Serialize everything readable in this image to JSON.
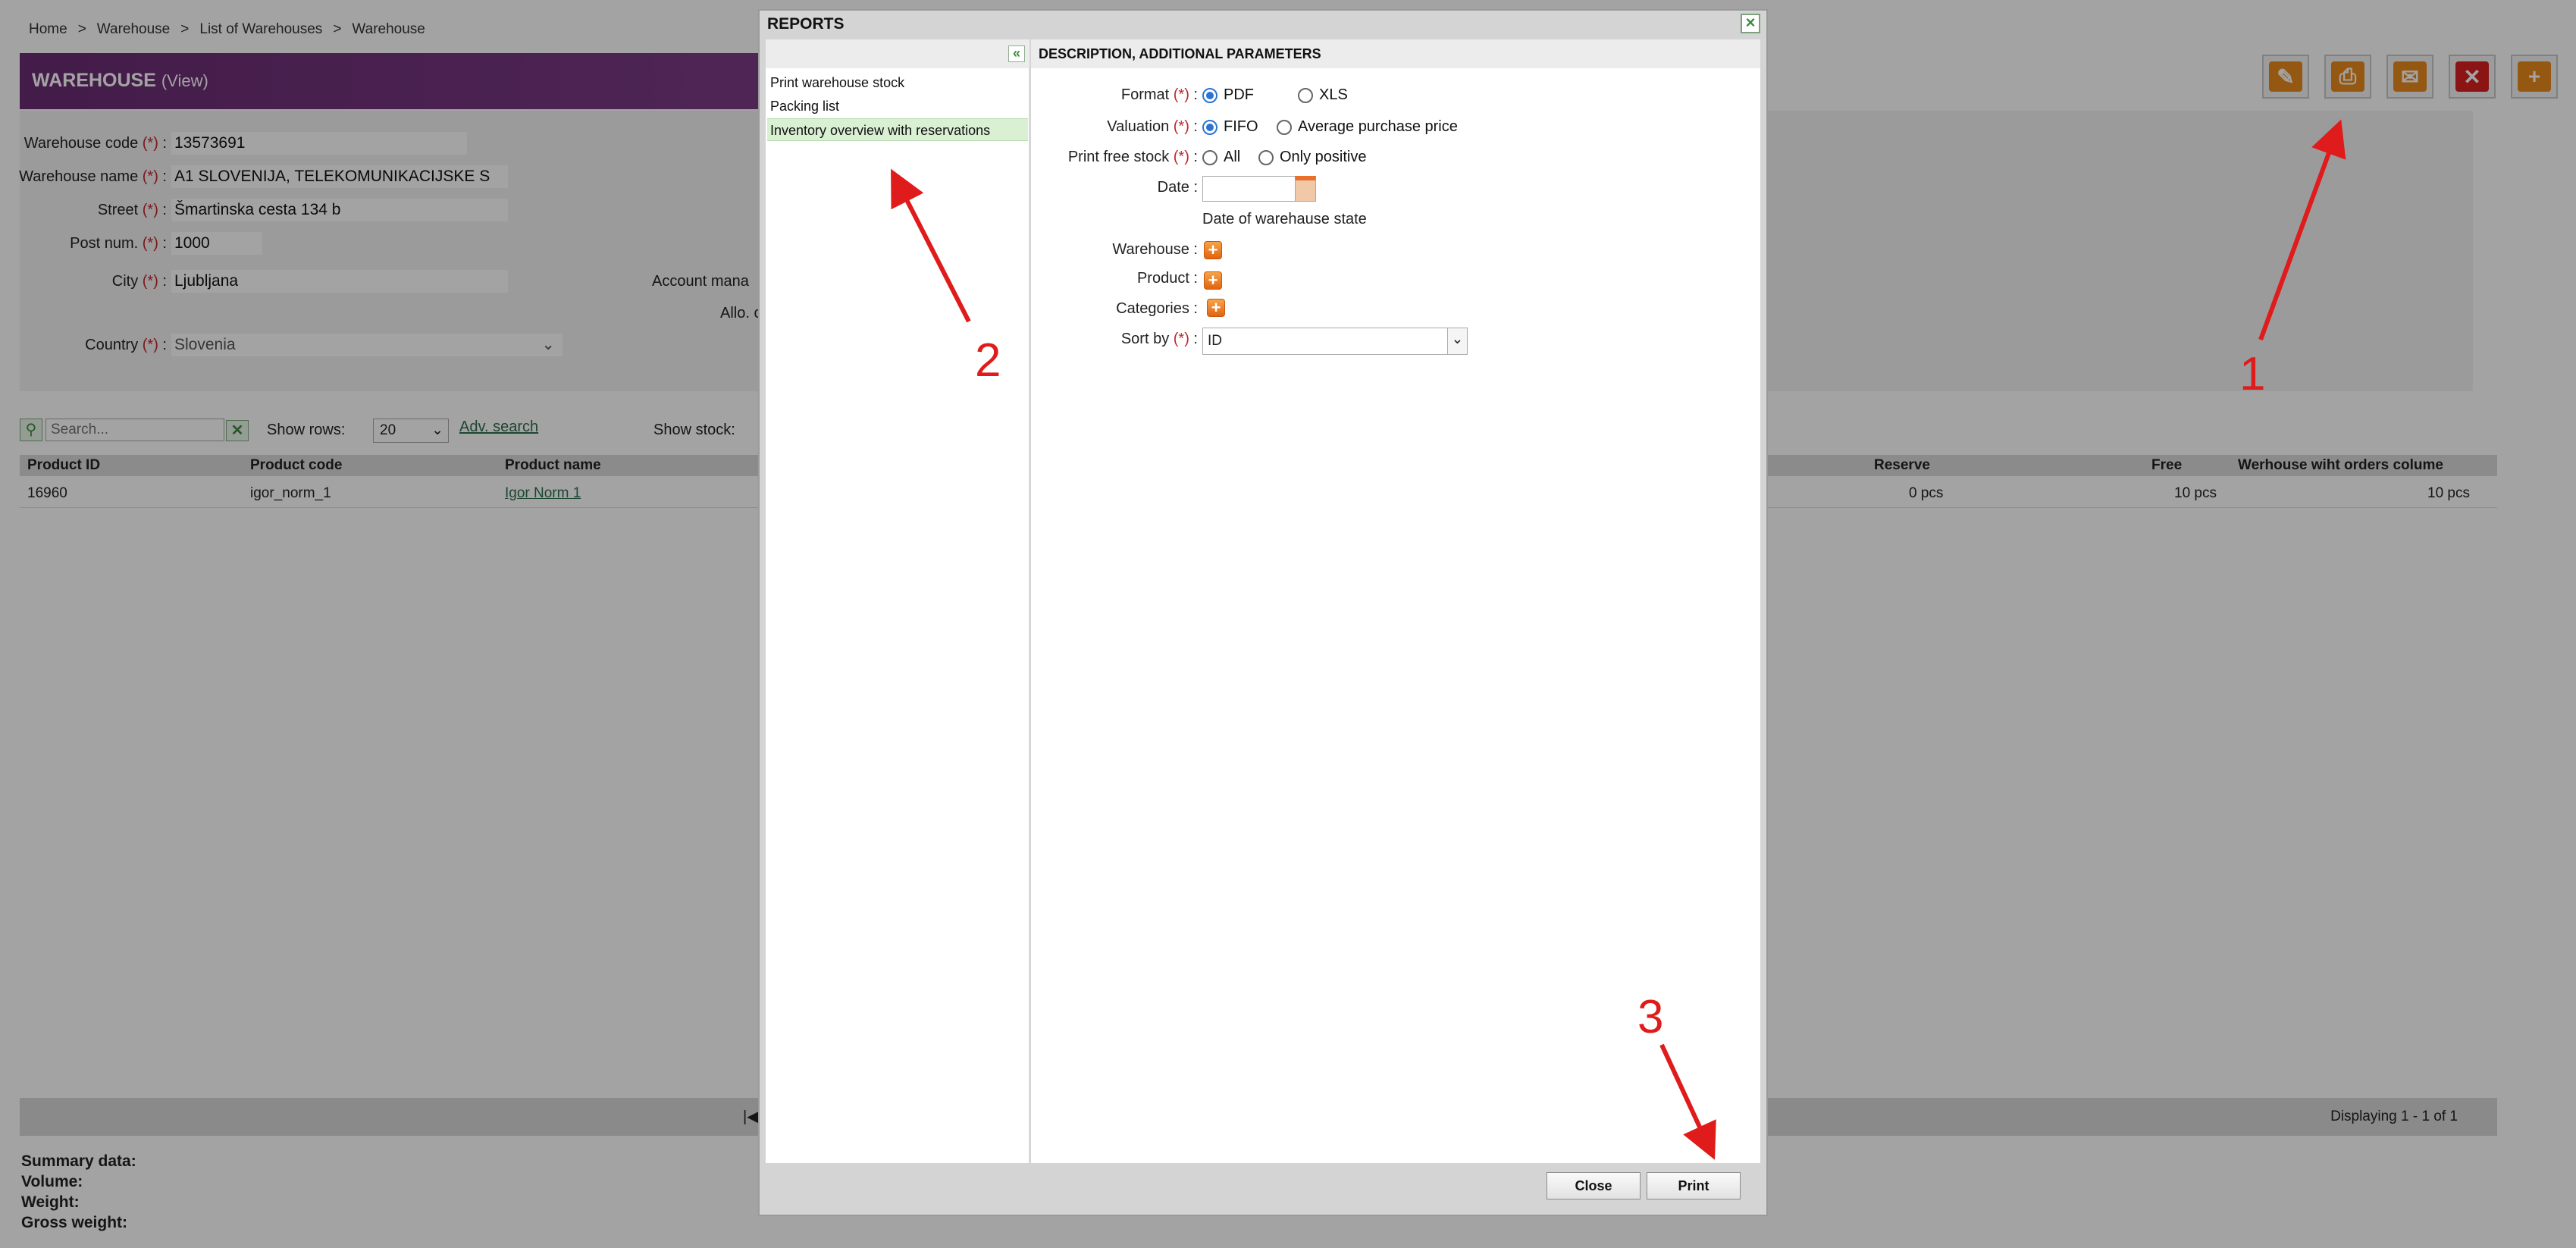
{
  "breadcrumb": [
    "Home",
    "Warehouse",
    "List of Warehouses",
    "Warehouse"
  ],
  "breadcrumb_sep": ">",
  "header": {
    "title": "WAREHOUSE",
    "mode": "(View)"
  },
  "required_mark": "(*)",
  "form": {
    "warehouse_code_label": "Warehouse code",
    "warehouse_code": "13573691",
    "warehouse_name_label": "Warehouse name",
    "warehouse_name": "A1 SLOVENIJA, TELEKOMUNIKACIJSKE S",
    "street_label": "Street",
    "street": "Šmartinska cesta 134 b",
    "post_label": "Post num.",
    "post": "1000",
    "city_label": "City",
    "city": "Ljubljana",
    "country_label": "Country",
    "country": "Slovenia",
    "account_manager_label": "Account mana",
    "allo_label": "Allo. c"
  },
  "grid": {
    "search_placeholder": "Search...",
    "show_rows_label": "Show rows:",
    "show_rows_value": "20",
    "adv_search": "Adv. search",
    "show_stock_label": "Show stock:",
    "columns": {
      "product_id": "Product ID",
      "product_code": "Product code",
      "product_name": "Product name",
      "reserve": "Reserve",
      "free": "Free",
      "with_orders": "Werhouse wiht orders colume"
    },
    "row": {
      "product_id": "16960",
      "product_code": "igor_norm_1",
      "product_name": "Igor Norm 1",
      "reserve": "0 pcs",
      "free": "10 pcs",
      "with_orders": "10 pcs"
    },
    "displaying": "Displaying 1 - 1 of 1",
    "pager_first": "|◀"
  },
  "summary": {
    "title": "Summary data:",
    "volume": "Volume:",
    "weight": "Weight:",
    "gross_weight": "Gross weight:"
  },
  "dialog": {
    "title": "REPORTS",
    "close_icon": "×",
    "collapse_icon": "«",
    "reports": [
      "Print warehouse stock",
      "Packing list",
      "Inventory overview with reservations"
    ],
    "selected_report": 2,
    "params_header": "DESCRIPTION, ADDITIONAL PARAMETERS",
    "format_label": "Format",
    "format_options": [
      "PDF",
      "XLS"
    ],
    "valuation_label": "Valuation",
    "valuation_options": [
      "FIFO",
      "Average purchase price"
    ],
    "free_stock_label": "Print free stock",
    "free_stock_options": [
      "All",
      "Only positive"
    ],
    "date_label": "Date :",
    "date_value": "",
    "date_hint": "Date of warehause state",
    "warehouse_label": "Warehouse :",
    "product_label": "Product :",
    "categories_label": "Categories :",
    "sort_label": "Sort by",
    "sort_value": "ID",
    "close_button": "Close",
    "print_button": "Print"
  },
  "annotations": {
    "one": "1",
    "two": "2",
    "three": "3",
    "color": "#e01b1b"
  },
  "icons": [
    "edit-icon",
    "print-icon",
    "email-icon",
    "delete-icon",
    "add-icon"
  ]
}
